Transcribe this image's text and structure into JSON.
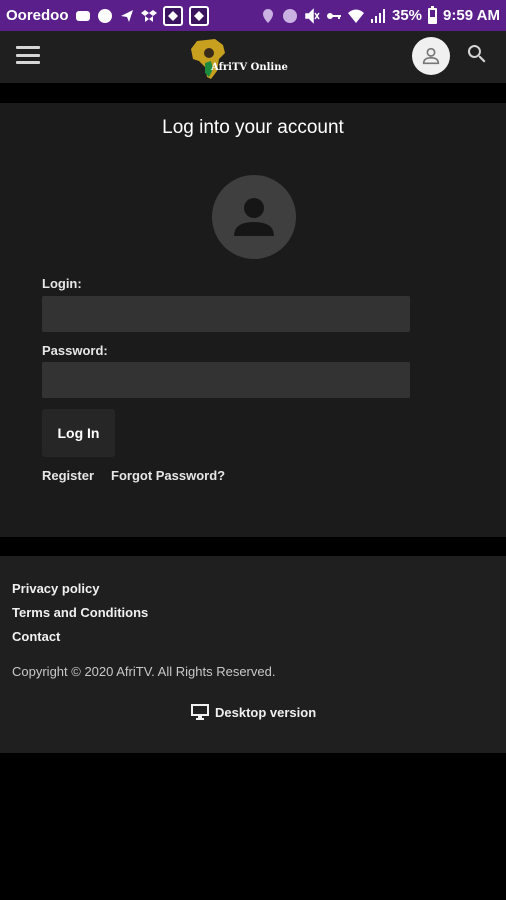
{
  "status_bar": {
    "carrier": "Ooredoo",
    "battery": "35%",
    "time": "9:59 AM",
    "bg_color": "#5a1f8a"
  },
  "header": {
    "logo_text": "AfriTV Online",
    "icons": [
      "menu-icon",
      "user-icon",
      "search-icon"
    ]
  },
  "login": {
    "title": "Log into your account",
    "login_label": "Login:",
    "login_value": "",
    "password_label": "Password:",
    "password_value": "",
    "submit_label": "Log In",
    "register_label": "Register",
    "forgot_label": "Forgot Password?"
  },
  "footer": {
    "links": [
      "Privacy policy",
      "Terms and Conditions",
      "Contact"
    ],
    "copyright": "Copyright © 2020 AfriTV. All Rights Reserved.",
    "desktop_label": "Desktop version"
  }
}
